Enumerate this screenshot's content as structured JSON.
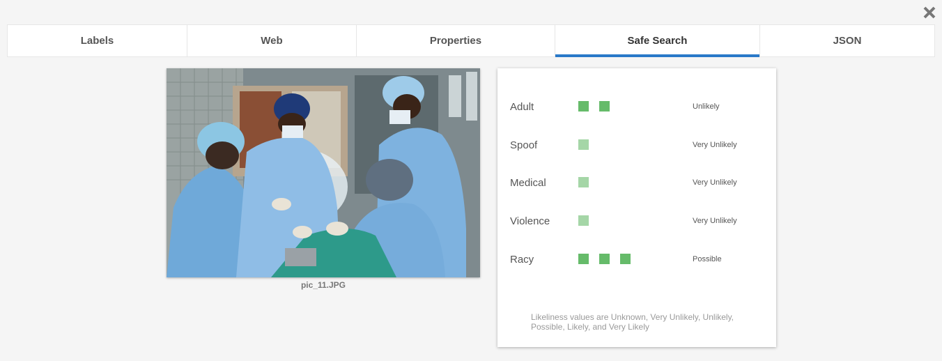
{
  "tabs": [
    {
      "label": "Labels",
      "active": false
    },
    {
      "label": "Web",
      "active": false
    },
    {
      "label": "Properties",
      "active": false
    },
    {
      "label": "Safe Search",
      "active": true
    },
    {
      "label": "JSON",
      "active": false
    }
  ],
  "colors": {
    "accent": "#2979c8",
    "bar_strong": "#66bb6a",
    "bar_light": "#a5d6a7"
  },
  "image": {
    "caption": "pic_11.JPG"
  },
  "safe_search": {
    "rows": [
      {
        "name": "Adult",
        "value": "Unlikely",
        "level": 2
      },
      {
        "name": "Spoof",
        "value": "Very Unlikely",
        "level": 1
      },
      {
        "name": "Medical",
        "value": "Very Unlikely",
        "level": 1
      },
      {
        "name": "Violence",
        "value": "Very Unlikely",
        "level": 1
      },
      {
        "name": "Racy",
        "value": "Possible",
        "level": 3
      }
    ],
    "note": "Likeliness values are Unknown, Very Unlikely, Unlikely, Possible, Likely, and Very Likely"
  },
  "icons": {
    "close": "close-icon"
  }
}
